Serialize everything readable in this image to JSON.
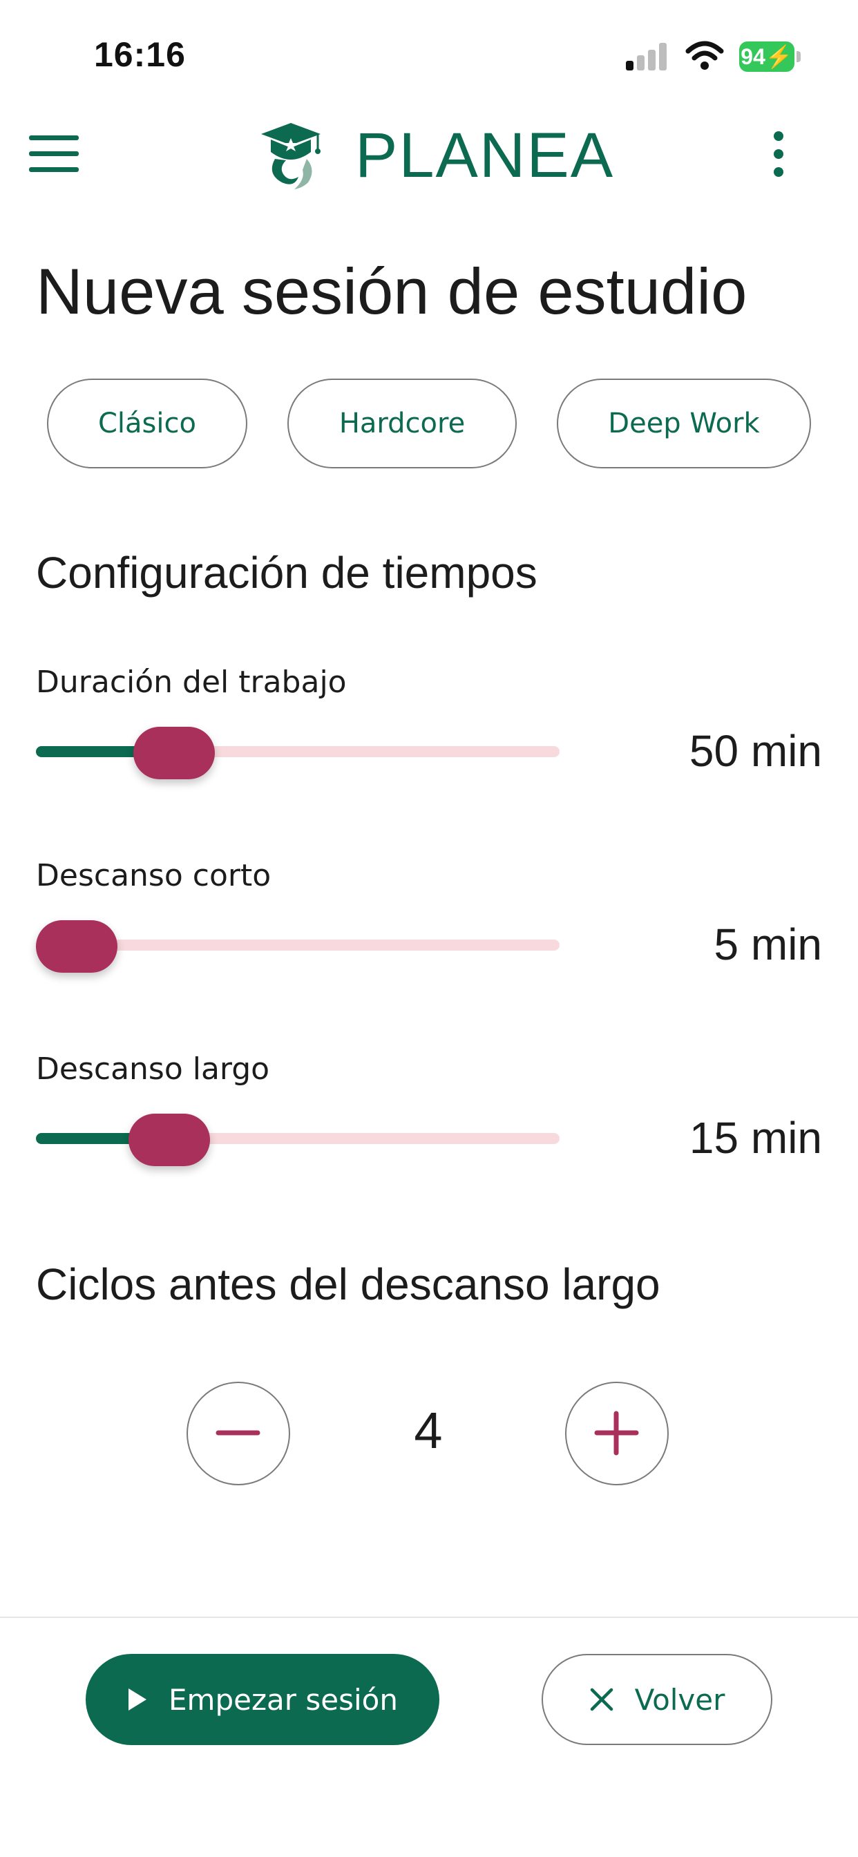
{
  "status_bar": {
    "time": "16:16",
    "battery": "94"
  },
  "app_bar": {
    "brand": "PLANEA",
    "menu_icon": "hamburger-menu-icon",
    "more_icon": "more-vertical-icon"
  },
  "page": {
    "title": "Nueva sesión de estudio"
  },
  "presets": [
    {
      "label": "Clásico"
    },
    {
      "label": "Hardcore"
    },
    {
      "label": "Deep Work"
    }
  ],
  "timing": {
    "title": "Configuración de tiempos",
    "sliders": [
      {
        "label": "Duración del trabajo",
        "value": 50,
        "value_label": "50 min",
        "fill": 0.22
      },
      {
        "label": "Descanso corto",
        "value": 5,
        "value_label": "5 min",
        "fill": 0.0
      },
      {
        "label": "Descanso largo",
        "value": 15,
        "value_label": "15 min",
        "fill": 0.21
      }
    ]
  },
  "cycles": {
    "title": "Ciclos antes del descanso largo",
    "value": "4"
  },
  "actions": {
    "start_label": "Empezar sesión",
    "back_label": "Volver"
  },
  "colors": {
    "primary": "#0b6a4f",
    "accent": "#a8305a",
    "track_inactive": "#f8dade"
  }
}
